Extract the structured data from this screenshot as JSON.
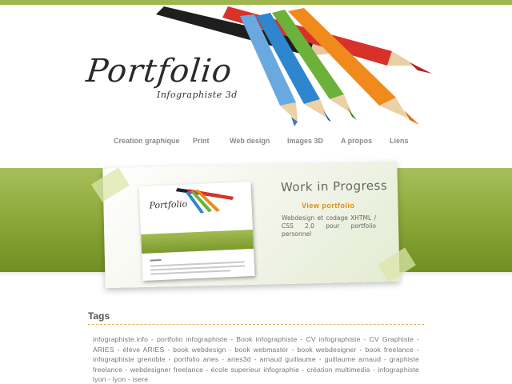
{
  "header": {
    "logo_title": "Portfolio",
    "logo_subtitle": "Infographiste 3d"
  },
  "nav": {
    "items": [
      {
        "label": "Creation graphique"
      },
      {
        "label": "Print"
      },
      {
        "label": "Web design"
      },
      {
        "label": "Images 3D"
      },
      {
        "label": "A propos"
      },
      {
        "label": "Liens"
      }
    ]
  },
  "showcase": {
    "title": "Work in Progress",
    "link_label": "View  portfolio",
    "description": "Webdesign et codage XHTML / CSS 2.0 pour portfolio personnel",
    "thumbnail_logo": "Portfolio"
  },
  "tags": {
    "heading": "Tags",
    "text": "infographiste.info - portfolio infographiste - Book infographiste - CV infographiste - CV Graphiste - ARIES - élève ARIES - book webdesign - book webmaster - book webdesigner - book freelance - infographiste grenoble - portfolio aries - aries3d - arnaud guillaume - guillaume arnaud - graphiste freelance - webdesigner freelance - école superieur infographie - création multimedia - infographiste lyon - lyon - isere"
  },
  "colors": {
    "accent_green": "#8faa3b",
    "link_orange": "#e08b12",
    "tag_rule": "#e0b15a"
  }
}
